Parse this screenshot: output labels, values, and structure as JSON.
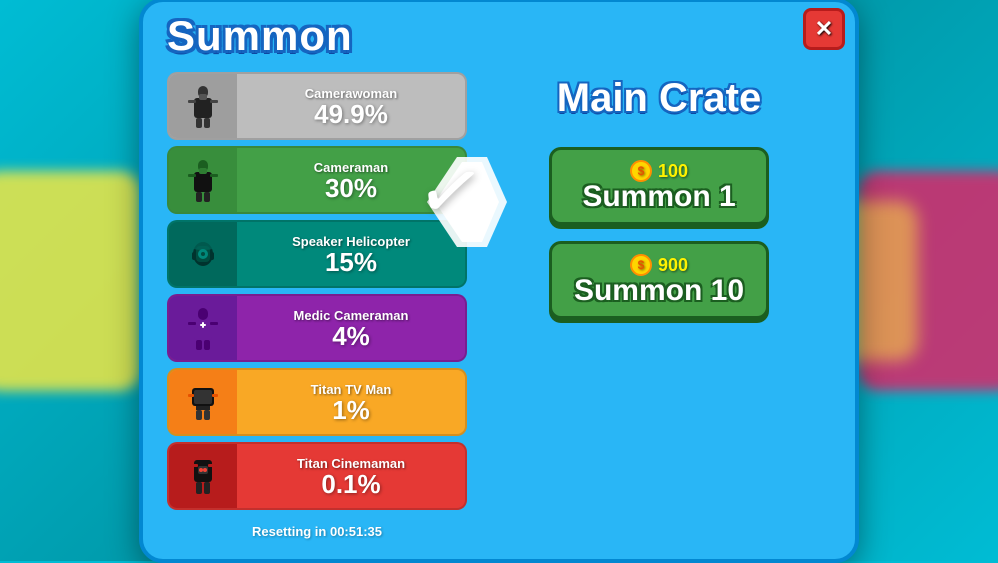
{
  "modal": {
    "title": "Summon",
    "close_label": "✕"
  },
  "items": [
    {
      "id": "camerawoman",
      "name": "Camerawoman",
      "pct": "49.9%",
      "color_class": "row-gray",
      "icon": "📷"
    },
    {
      "id": "cameraman",
      "name": "Cameraman",
      "pct": "30%",
      "color_class": "row-green",
      "icon": "🎥"
    },
    {
      "id": "speaker-helicopter",
      "name": "Speaker Helicopter",
      "pct": "15%",
      "color_class": "row-teal",
      "icon": "🔊"
    },
    {
      "id": "medic-cameraman",
      "name": "Medic Cameraman",
      "pct": "4%",
      "color_class": "row-purple",
      "icon": "⚕️"
    },
    {
      "id": "titan-tv-man",
      "name": "Titan TV Man",
      "pct": "1%",
      "color_class": "row-yellow",
      "icon": "📺"
    },
    {
      "id": "titan-cinemaman",
      "name": "Titan Cinemaman",
      "pct": "0.1%",
      "color_class": "row-red",
      "icon": "🎬"
    }
  ],
  "crate": {
    "title": "Main Crate",
    "summon1": {
      "cost": "100",
      "label": "Summon 1"
    },
    "summon10": {
      "cost": "900",
      "label": "Summon 10"
    }
  },
  "reset_text": "Resetting in 00:51:35",
  "colors": {
    "accent_blue": "#29b6f6",
    "green_btn": "#43a047",
    "red_close": "#e53935"
  }
}
